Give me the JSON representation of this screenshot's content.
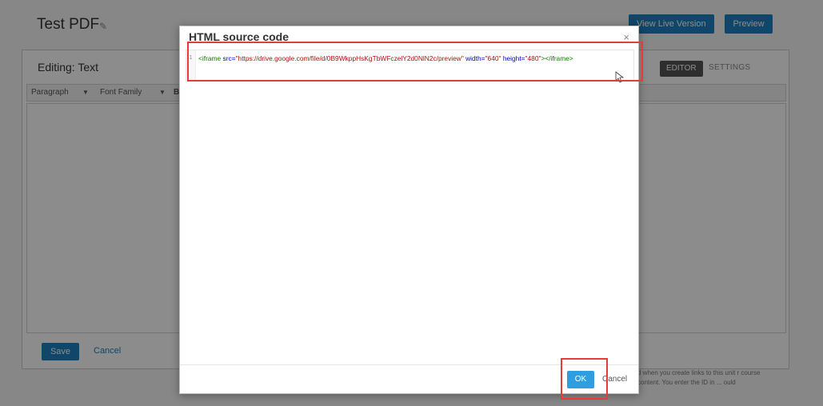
{
  "page": {
    "title": "Test PDF",
    "buttons": {
      "live": "View Live Version",
      "preview": "Preview"
    }
  },
  "editor": {
    "heading": "Editing: Text",
    "tabs": {
      "editor": "EDITOR",
      "settings": "SETTINGS"
    },
    "toolbar": {
      "paragraph": "Paragraph",
      "font_family": "Font Family",
      "bold": "B"
    },
    "save_label": "Save",
    "cancel_label": "Cancel",
    "help_text": "d when you create links to this unit r course content. You enter the ID in ... ould"
  },
  "modal": {
    "title": "HTML source code",
    "close": "×",
    "code": {
      "line_number": "1",
      "open_tag": "<iframe",
      "src_attr": "src=",
      "src_value": "\"https://drive.google.com/file/d/0B9WkppHsKgTbWFczelY2d0NlN2c/preview\"",
      "width_attr": "width=",
      "width_value": "\"640\"",
      "height_attr": "height=",
      "height_value": "\"480\"",
      "close_tag": "></iframe>"
    },
    "ok_label": "OK",
    "cancel_label": "Cancel"
  },
  "colors": {
    "accent": "#1d80bf",
    "highlight": "#e43b3b",
    "ok_button": "#2d9ee0"
  }
}
